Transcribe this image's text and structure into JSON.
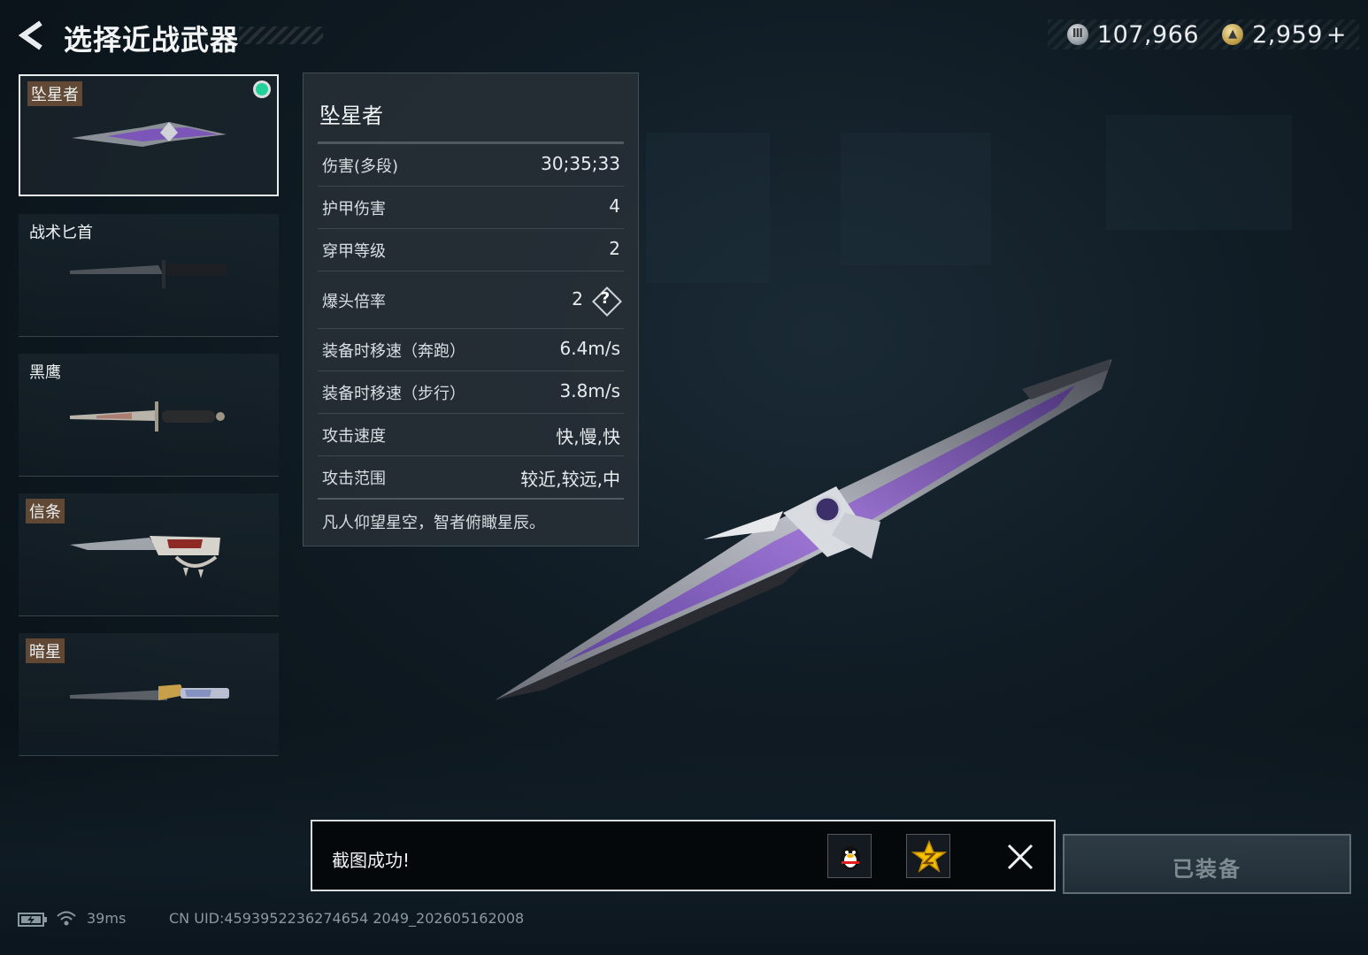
{
  "header": {
    "title": "选择近战武器"
  },
  "currency": {
    "silver": "107,966",
    "gold": "2,959",
    "plus": "+"
  },
  "weapons": [
    {
      "name": "坠星者",
      "selected": true,
      "equipped": true
    },
    {
      "name": "战术匕首"
    },
    {
      "name": "黑鹰"
    },
    {
      "name": "信条"
    },
    {
      "name": "暗星"
    }
  ],
  "stats": {
    "name": "坠星者",
    "rows": [
      {
        "label": "伤害(多段)",
        "value": "30;35;33"
      },
      {
        "label": "护甲伤害",
        "value": "4"
      },
      {
        "label": "穿甲等级",
        "value": "2"
      },
      {
        "label": "爆头倍率",
        "value": "2"
      },
      {
        "label": "装备时移速（奔跑）",
        "value": "6.4m/s"
      },
      {
        "label": "装备时移速（步行）",
        "value": "3.8m/s"
      },
      {
        "label": "攻击速度",
        "value": "快,慢,快"
      },
      {
        "label": "攻击范围",
        "value": "较近,较远,中"
      }
    ],
    "help_glyph": "?",
    "quote": "凡人仰望星空，智者俯瞰星辰。"
  },
  "toast": {
    "text": "截图成功!"
  },
  "equip_button": {
    "label": "已装备"
  },
  "status": {
    "ping": "39ms",
    "uid": "CN UID:4593952236274654 2049_202605162008"
  },
  "colors": {
    "equipped": "#22d19a",
    "accent_purple": "#8a5cc8"
  }
}
